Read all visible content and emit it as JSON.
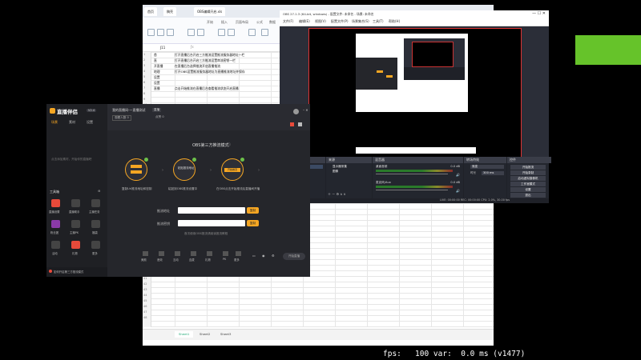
{
  "spreadsheet": {
    "tabs": [
      "首页",
      "稿壳",
      "OBS编辑开启.xls"
    ],
    "ribbon_tabs": [
      "开始",
      "插入",
      "页面布局",
      "公式",
      "数据",
      "审阅",
      "视图",
      "开发工具",
      "特色功能"
    ],
    "cell_ref": "J11",
    "rows": [
      "1",
      "2",
      "3",
      "4",
      "5",
      "6",
      "7",
      "8",
      "9",
      "10",
      "11",
      "12",
      "13",
      "14",
      "15",
      "16",
      "17",
      "18",
      "19",
      "20",
      "21",
      "22",
      "23",
      "24",
      "25",
      "26",
      "27",
      "28",
      "29",
      "30",
      "31",
      "32",
      "33",
      "34",
      "35",
      "36",
      "37",
      "38",
      "39",
      "40",
      "41",
      "42",
      "43",
      "44",
      "45",
      "46",
      "47",
      "48"
    ],
    "cells": [
      {
        "r": 0,
        "c0": "首",
        "c1": "打开直播后台开启三方推流设置推流服务器地址一栏"
      },
      {
        "r": 1,
        "c0": "直",
        "c1": "打开直播后台开启三方推流设置串流密钥一栏"
      },
      {
        "r": 2,
        "c0": "开直播",
        "c1": "在直播后台选择推流开启直播推流"
      },
      {
        "r": 3,
        "c0": "地理",
        "c1": "打开OBS设置推流服务器地址为直播推流地址并保存"
      },
      {
        "r": 4,
        "c0": "设置",
        "c1": ""
      },
      {
        "r": 5,
        "c0": "设置",
        "c1": ""
      },
      {
        "r": 6,
        "c0": "直播",
        "c1": "点击开始推流在直播后台查看推流状态开启直播"
      }
    ],
    "sheet_tabs": [
      "Sheet1",
      "Sheet2",
      "Sheet3"
    ]
  },
  "obs": {
    "title": "OBS 27.1.3 (64-bit, windows) - 配置文件: 未命名 - 场景: 未命名",
    "menu": [
      "文件(F)",
      "编辑(E)",
      "视图(V)",
      "配置文件(P)",
      "场景集合(S)",
      "工具(T)",
      "帮助(H)"
    ],
    "docks": [
      "场景",
      "来源",
      "混音器",
      "转场特效",
      "控件"
    ],
    "scene_item": "场景",
    "source_items": [
      "显示器采集",
      "图像"
    ],
    "mixer_tracks": [
      "桌面音频",
      "麦克风/Aux"
    ],
    "mixer_levels": [
      "0.0 dB",
      "0.0 dB"
    ],
    "transition": "渐变",
    "duration_label": "时长",
    "duration": "300 ms",
    "controls": [
      "开始推流",
      "开始录制",
      "启动虚拟摄像机",
      "工作室模式",
      "设置",
      "退出"
    ],
    "status": "LIVE: 00:00:00   REC: 00:00:00   CPU: 2.0%, 30.00 fps"
  },
  "stream_app": {
    "logo": "直播伴侣",
    "version": "V2.4",
    "side_tabs": [
      "场景",
      "素材",
      "设置"
    ],
    "side_placeholder": "点击添加素材，开始你的直播吧",
    "tools_title": "工具箱",
    "tools": [
      "直播设置",
      "直播助手",
      "主播任务",
      "粉丝团",
      "主播PK",
      "福袋",
      "活动",
      "礼物",
      "更多"
    ],
    "live_title": "我的直播间-一直播测试",
    "live_badge": "直播",
    "live_meta": [
      "观看人数 0",
      "点赞 0"
    ],
    "mode_title": "OBS第三方推流模式",
    "steps": [
      {
        "label": "复制推流地址",
        "caption": "复制Url推流地址和密钥"
      },
      {
        "label": "粘贴推流地址",
        "caption": "粘贴到OBS推流设置中"
      },
      {
        "label": "开始推流",
        "caption": "在OBS点击开始推流后直播间开播"
      }
    ],
    "field_labels": [
      "推流地址",
      "推流密钥"
    ],
    "copy_btn": "复制",
    "hint": "首次使用OBS推流请阅读推流教程",
    "bottom_icons": [
      "美颜",
      "音效",
      "互动",
      "连麦",
      "礼物",
      "PK",
      "更多"
    ],
    "start_btn": "开始直播",
    "footer": "如何开启第三方推流模式"
  },
  "overlay": {
    "fps": "fps:   100 var:  0.0 ms (v1477)"
  },
  "colors": {
    "accent": "#f5a623",
    "obs_preview_border": "#dd3333",
    "banner": "#66c32a"
  }
}
